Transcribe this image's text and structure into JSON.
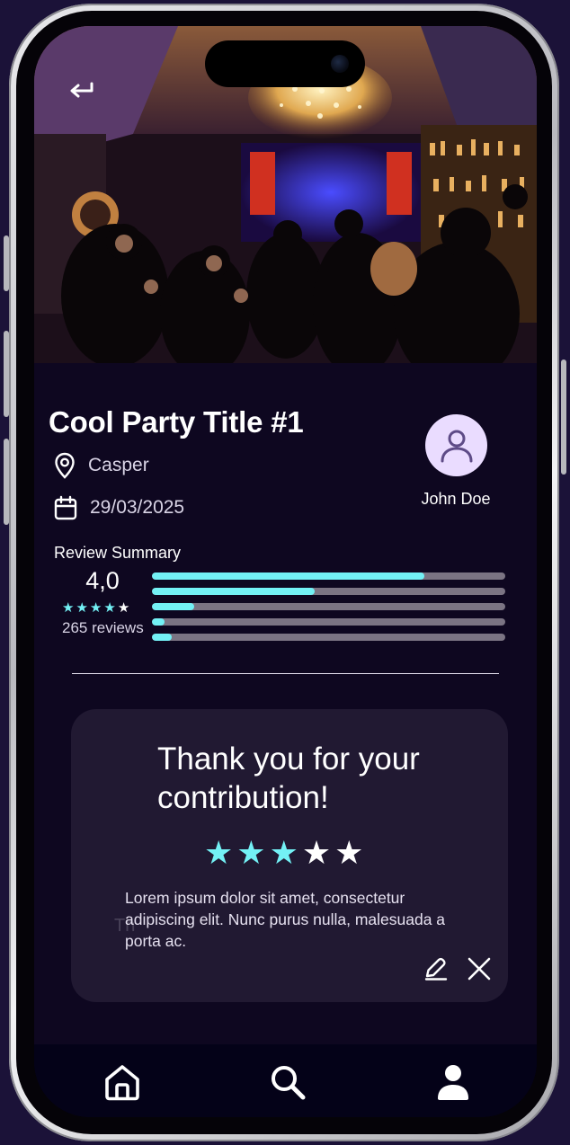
{
  "event": {
    "title": "Cool Party Title #1",
    "location": "Casper",
    "date": "29/03/2025"
  },
  "host": {
    "name": "John Doe"
  },
  "review_summary": {
    "label": "Review Summary",
    "rating": "4,0",
    "stars_filled": 4,
    "stars_total": 5,
    "count_text": "265 reviews",
    "distribution": [
      0.77,
      0.46,
      0.12,
      0.035,
      0.055
    ]
  },
  "contribution": {
    "heading": "Thank you for your contribution!",
    "stars_filled": 3,
    "stars_total": 5,
    "ghost_text": "Th",
    "body": "Lorem ipsum dolor sit amet, consectetur adipiscing elit. Nunc purus nulla, malesuada a porta ac."
  },
  "icons": {
    "back": "back-arrow-icon",
    "location": "map-pin-icon",
    "date": "calendar-icon",
    "avatar": "user-icon",
    "edit": "pencil-icon",
    "close": "close-icon",
    "home": "home-icon",
    "search": "search-icon",
    "profile": "profile-icon"
  },
  "colors": {
    "accent": "#73f1f5",
    "background": "#0e0720",
    "card": "#211932",
    "avatar_bg": "#eadcff",
    "nav_bg": "#040218"
  }
}
